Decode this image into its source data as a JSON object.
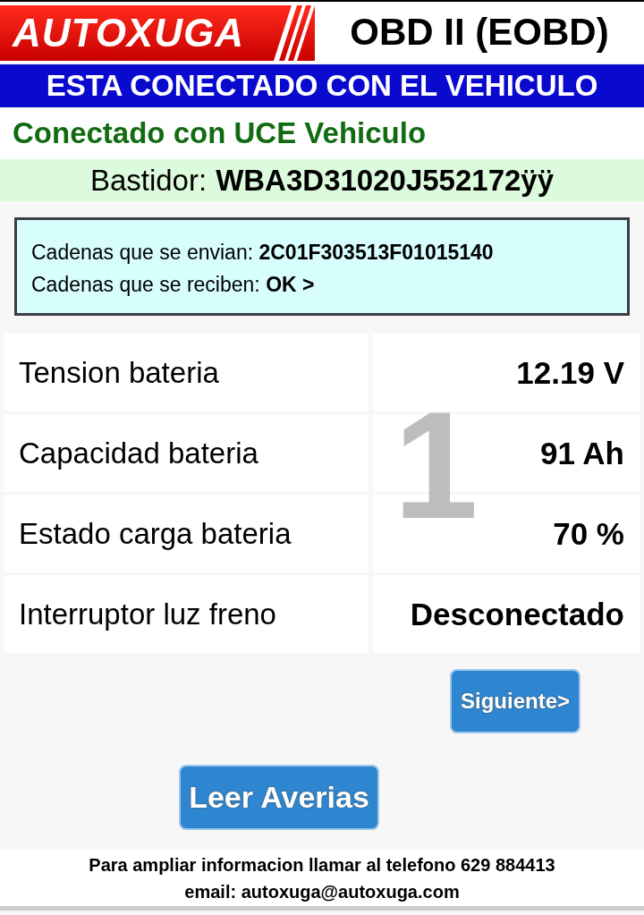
{
  "header": {
    "logo": "AUTOXUGA",
    "title": "OBD II (EOBD)"
  },
  "connection_banner": "ESTA CONECTADO CON EL VEHICULO",
  "ecu_status": "Conectado con UCE Vehiculo",
  "vin": {
    "label": "Bastidor:",
    "value": "WBA3D31020J552172ÿÿ"
  },
  "strings": [
    {
      "label": "Cadenas que se envian:",
      "value": "2C01F303513F01015140"
    },
    {
      "label": "Cadenas que se reciben:",
      "value": "OK >"
    }
  ],
  "readings": [
    {
      "name": "Tension bateria",
      "value": "12.19 V"
    },
    {
      "name": "Capacidad bateria",
      "value": "91 Ah"
    },
    {
      "name": "Estado carga bateria",
      "value": "70 %"
    },
    {
      "name": "Interruptor luz freno",
      "value": "Desconectado"
    }
  ],
  "page_number": "1",
  "buttons": [
    {
      "label": "Siguiente>",
      "kind": "small"
    },
    {
      "label": "Leer Averias",
      "kind": "large"
    }
  ],
  "footer": [
    "Para ampliar informacion llamar al telefono 629 884413",
    "email: autoxuga@autoxuga.com"
  ]
}
